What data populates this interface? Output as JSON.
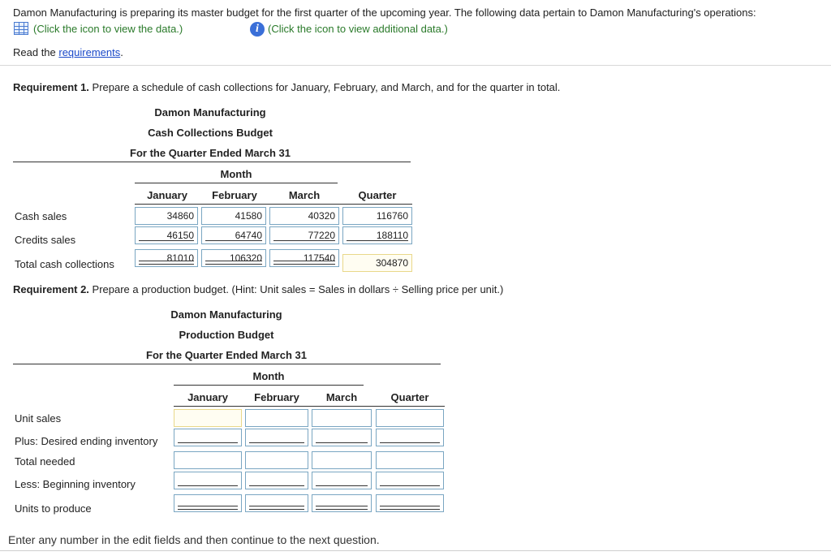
{
  "intro": {
    "text": "Damon Manufacturing is preparing its master budget for the first quarter of the upcoming year. The following data pertain to Damon Manufacturing's operations:",
    "data_link": "(Click the icon to view the data.)",
    "info_link": "(Click the icon to view additional data.)",
    "read_prefix": "Read the ",
    "requirements_link": "requirements",
    "read_suffix": "."
  },
  "req1": {
    "label": "Requirement 1.",
    "text": " Prepare a schedule of cash collections for January, February, and March, and for the quarter in total.",
    "company": "Damon Manufacturing",
    "title": "Cash Collections Budget",
    "period": "For the Quarter Ended March 31",
    "month_header": "Month",
    "columns": [
      "January",
      "February",
      "March",
      "Quarter"
    ],
    "rows": [
      {
        "label": "Cash sales",
        "values": [
          "34860",
          "41580",
          "40320",
          "116760"
        ]
      },
      {
        "label": "Credits sales",
        "values": [
          "46150",
          "64740",
          "77220",
          "188110"
        ]
      },
      {
        "label": "Total cash collections",
        "values": [
          "81010",
          "106320",
          "117540",
          "304870"
        ]
      }
    ]
  },
  "req2": {
    "label": "Requirement 2.",
    "text": " Prepare a production budget. (Hint: Unit sales = Sales in dollars ÷ Selling price per unit.)",
    "company": "Damon Manufacturing",
    "title": "Production Budget",
    "period": "For the Quarter Ended March 31",
    "month_header": "Month",
    "columns": [
      "January",
      "February",
      "March",
      "Quarter"
    ],
    "rows": [
      {
        "label": "Unit sales",
        "values": [
          "",
          "",
          "",
          ""
        ]
      },
      {
        "label": "Plus: Desired ending inventory",
        "values": [
          "",
          "",
          "",
          ""
        ]
      },
      {
        "label": "Total needed",
        "values": [
          "",
          "",
          "",
          ""
        ]
      },
      {
        "label": "Less: Beginning inventory",
        "values": [
          "",
          "",
          "",
          ""
        ]
      },
      {
        "label": "Units to produce",
        "values": [
          "",
          "",
          "",
          ""
        ]
      }
    ]
  },
  "footer": {
    "text": "Enter any number in the edit fields and then continue to the next question."
  },
  "colors": {
    "link_green": "#2a7a2a",
    "link_blue": "#1a49c9",
    "input_border": "#7aa6c2",
    "active_input_border": "#e9d88a"
  },
  "icons": {
    "data": "table-grid-icon",
    "info": "info-icon"
  }
}
